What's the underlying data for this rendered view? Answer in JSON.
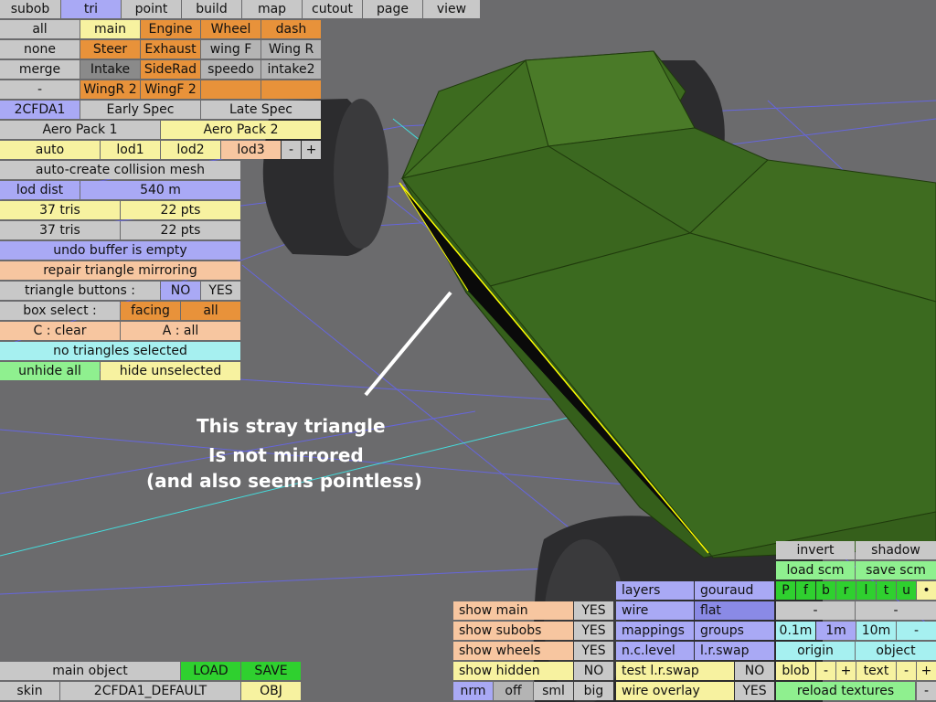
{
  "tabs": {
    "subob": "subob",
    "tri": "tri",
    "point": "point",
    "build": "build",
    "map": "map",
    "cutout": "cutout",
    "page": "page",
    "view": "view"
  },
  "subobjects": {
    "all": "all",
    "main": "main",
    "engine": "Engine",
    "wheel": "Wheel",
    "dash": "dash",
    "none": "none",
    "steer": "Steer",
    "exhaust": "Exhaust",
    "wingf": "wing F",
    "wingr": "Wing R",
    "merge": "merge",
    "intake": "Intake",
    "siderad": "SideRad",
    "speedo": "speedo",
    "intake2": "intake2",
    "dash_sep": "-",
    "wingr2": "WingR 2",
    "wingf2": "WingF 2"
  },
  "specs": {
    "car": "2CFDA1",
    "early": "Early Spec",
    "late": "Late Spec",
    "aero1": "Aero Pack 1",
    "aero2": "Aero Pack 2"
  },
  "lod": {
    "auto": "auto",
    "lod1": "lod1",
    "lod2": "lod2",
    "lod3": "lod3",
    "minus": "-",
    "plus": "+"
  },
  "panel": {
    "auto_collision": "auto-create collision mesh",
    "lod_dist_label": "lod dist",
    "lod_dist_value": "540 m",
    "tris1": "37 tris",
    "pts1": "22 pts",
    "tris2": "37 tris",
    "pts2": "22 pts",
    "undo": "undo buffer is empty",
    "repair": "repair triangle mirroring",
    "tri_buttons": "triangle buttons :",
    "no": "NO",
    "yes": "YES",
    "box_select": "box select :",
    "facing": "facing",
    "all": "all",
    "clear": "C : clear",
    "select_all": "A : all",
    "no_selected": "no triangles selected",
    "unhide_all": "unhide all",
    "hide_unselected": "hide unselected"
  },
  "annotation": {
    "line1": "This stray triangle",
    "line2": "Is not mirrored",
    "line3": "(and also seems pointless)"
  },
  "bottom_left": {
    "main_object": "main object",
    "load": "LOAD",
    "save": "SAVE",
    "skin": "skin",
    "skin_name": "2CFDA1_DEFAULT",
    "obj": "OBJ"
  },
  "show": {
    "main": "show main",
    "main_val": "YES",
    "subobs": "show subobs",
    "subobs_val": "YES",
    "wheels": "show wheels",
    "wheels_val": "YES",
    "hidden": "show hidden",
    "hidden_val": "NO",
    "nrm": "nrm",
    "off": "off",
    "sml": "sml",
    "big": "big"
  },
  "render": {
    "layers": "layers",
    "gouraud": "gouraud",
    "wire": "wire",
    "flat": "flat",
    "mappings": "mappings",
    "groups": "groups",
    "nclevel": "n.c.level",
    "lrswap": "l.r.swap",
    "test_lrswap": "test l.r.swap",
    "test_lrswap_val": "NO",
    "wire_overlay": "wire overlay",
    "wire_overlay_val": "YES"
  },
  "right": {
    "invert": "invert",
    "shadow": "shadow",
    "load_scm": "load scm",
    "save_scm": "save scm",
    "views": [
      "P",
      "f",
      "b",
      "r",
      "l",
      "t",
      "u",
      "•"
    ],
    "minus1": "-",
    "minus2": "-",
    "g01": "0.1m",
    "g1": "1m",
    "g10": "10m",
    "gminus": "-",
    "origin": "origin",
    "object": "object",
    "blob": "blob",
    "blob_minus": "-",
    "blob_plus": "+",
    "text": "text",
    "text_minus": "-",
    "text_plus": "+",
    "reload": "reload textures",
    "reload_minus": "-"
  },
  "colors": {
    "background": "#6b6b6d",
    "car_body": "#3d6b1f",
    "tyre": "#2c2c2e",
    "selected_edge": "#ffff00",
    "grid": "#6666dd",
    "axis": "#44dddd"
  }
}
